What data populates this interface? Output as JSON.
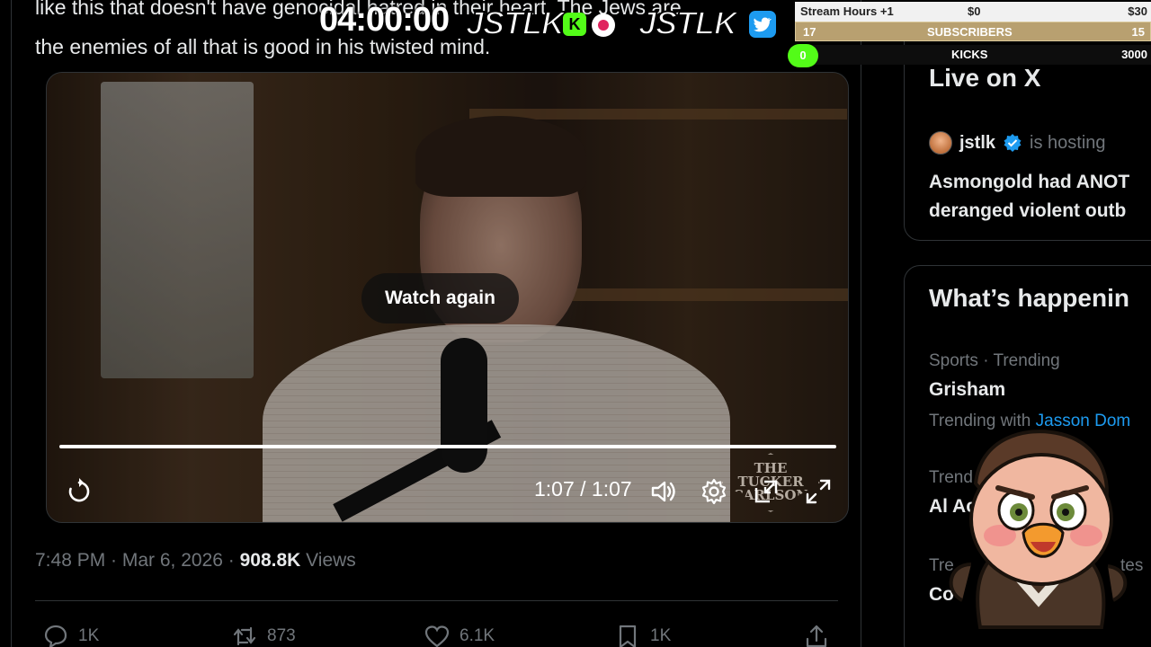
{
  "tweet": {
    "text_line1": "like this that doesn't have genocidal hatred in their heart. The Jews are",
    "text_line2": "the enemies of all that is good in his twisted mind.",
    "video": {
      "overlay_button": "Watch again",
      "time": "1:07 / 1:07",
      "progress": 1.0,
      "watermark": "THE TUCKER CARLSON"
    },
    "timestamp": "7:48 PM · Mar 6, 2026 · ",
    "views_count": "908.8K",
    "views_label": " Views",
    "actions": {
      "replies": "1K",
      "reposts": "873",
      "likes": "6.1K",
      "bookmarks": "1K"
    }
  },
  "sidebar": {
    "live": {
      "title": "Live on X",
      "host_name": "jstlk",
      "host_status": "is hosting",
      "live_title_line1": "Asmongold had ANOT",
      "live_title_line2": "deranged violent outb"
    },
    "trending": {
      "title": "What’s happenin",
      "items": [
        {
          "meta": "Sports · Trending",
          "name": "Grisham",
          "sub_prefix": "Trending with ",
          "sub_link": "Jasson Dom"
        },
        {
          "meta": "Trend",
          "name": "Al Ac"
        },
        {
          "meta": "Tre",
          "meta_right": "tes",
          "name": "Co"
        }
      ]
    }
  },
  "overlay": {
    "timer": "04:00:00",
    "brand1": "JSTLK",
    "brand2": "JSTLK",
    "brand_colors": {
      "kick": "#53fc18",
      "twitter": "#1d9bf0",
      "record": "#e0245e"
    },
    "stats": {
      "row1_label": "Stream Hours +1",
      "row1_mid": "$0",
      "row1_right": "$30",
      "row2_left": "17",
      "row2_label": "SUBSCRIBERS",
      "row2_right": "15",
      "row3_left": "0",
      "row3_label": "KICKS",
      "row3_right": "3000"
    }
  }
}
